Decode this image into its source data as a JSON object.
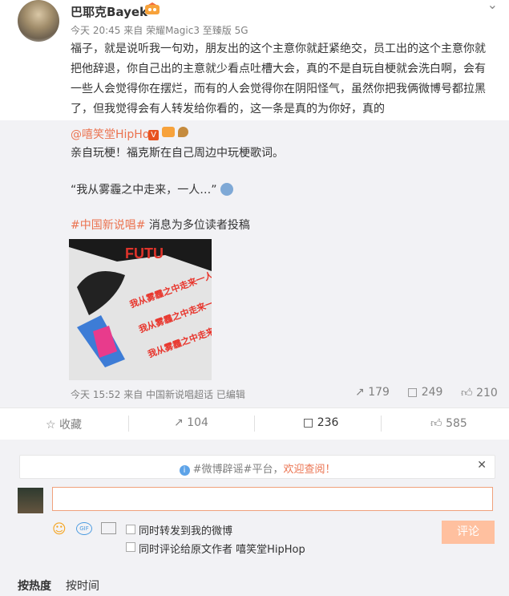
{
  "post": {
    "username": "巴耶克Bayek",
    "time": "今天 20:45",
    "from_label": "来自",
    "device": "荣耀Magic3 至臻版 5G",
    "text": "福子，就是说听我一句劝，朋友出的这个主意你就赶紧绝交，员工出的这个主意你就把他辞退，你自己出的主意就少看点吐槽大会，真的不是自玩自梗就会洗白啊，会有一些人会觉得你在摆烂，而有的人会觉得你在阴阳怪气，虽然你把我俩微博号都拉黑了，但我觉得会有人转发给你看的，这一条是真的为你好，真的"
  },
  "repost": {
    "author": "@嘻笑堂HipHop",
    "line1": "亲自玩梗！福克斯在自己周边中玩梗歌词。",
    "line2": "“我从雾霾之中走来，一人…”",
    "tag": "#中国新说唱#",
    "line3_rest": " 消息为多位读者投稿",
    "image_texts": [
      "我从雾霾之中走来一人",
      "我从雾霾之中走来一人",
      "我从雾霾之中走来一人"
    ],
    "meta": "今天 15:52 来自 中国新说唱超话  已编辑",
    "repost_count": "179",
    "comment_count": "249",
    "like_count": "210"
  },
  "actions": {
    "favorite": "收藏",
    "repost": "104",
    "comment": "236",
    "like": "585"
  },
  "comment_box": {
    "notice_prefix": "#微博辟谣#平台，",
    "notice_link": "欢迎查阅！",
    "input_value": "",
    "option1": "同时转发到我的微博",
    "option2": "同时评论给原文作者 嘻笑堂HipHop",
    "submit": "评论"
  },
  "sort": {
    "hot": "按热度",
    "time": "按时间"
  },
  "colors": {
    "accent": "#eb7350",
    "submit_disabled": "#ffc09f",
    "gray_bg": "#f2f2f5"
  }
}
